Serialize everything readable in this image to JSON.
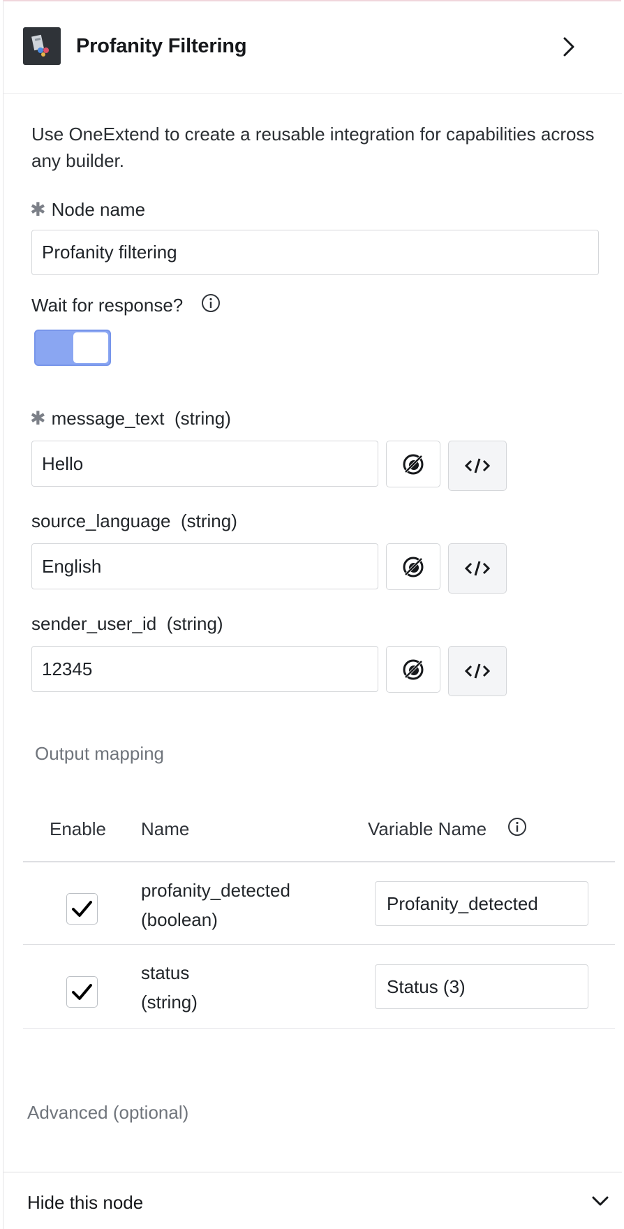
{
  "header": {
    "title": "Profanity Filtering",
    "logo_icon": "profanity-filter-app-logo",
    "expand_icon": "chevron-right-icon"
  },
  "description": "Use OneExtend to create a reusable integration for capabilities across any builder.",
  "node_name": {
    "required_marker": "✱",
    "label": "Node name",
    "value": "Profanity filtering"
  },
  "wait_for_response": {
    "label": "Wait for response?",
    "info_icon": "info-icon",
    "enabled": true,
    "accent_color": "#8aa6f2"
  },
  "inputs": [
    {
      "required": true,
      "required_marker": "✱",
      "name": "message_text",
      "type": "(string)",
      "value": "Hello"
    },
    {
      "required": false,
      "name": "source_language",
      "type": "(string)",
      "value": "English"
    },
    {
      "required": false,
      "name": "sender_user_id",
      "type": "(string)",
      "value": "12345"
    }
  ],
  "input_buttons": {
    "variable_icon": "variable-picker-icon",
    "code_icon": "code-icon",
    "code_label": "</>"
  },
  "output_mapping": {
    "title": "Output mapping",
    "columns": {
      "enable": "Enable",
      "name": "Name",
      "variable_name": "Variable Name"
    },
    "rows": [
      {
        "enabled": true,
        "name": "profanity_detected",
        "type": "(boolean)",
        "variable": "Profanity_detected"
      },
      {
        "enabled": true,
        "name": "status",
        "type": "(string)",
        "variable": "Status (3)"
      }
    ]
  },
  "advanced": {
    "label": "Advanced (optional)"
  },
  "footer": {
    "label": "Hide this node",
    "icon": "chevron-down-icon"
  }
}
